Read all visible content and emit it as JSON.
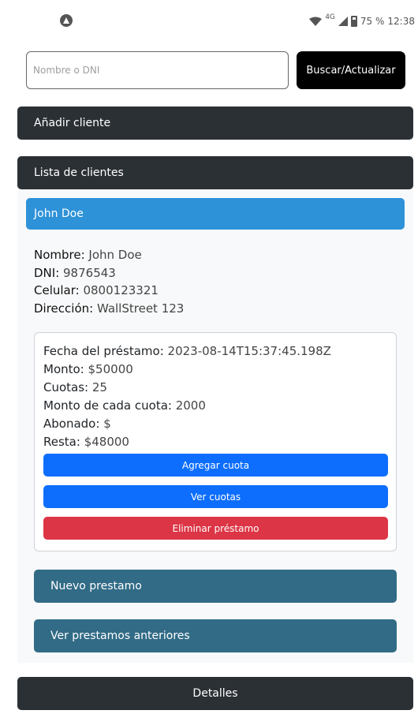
{
  "status_bar": {
    "network": "4G",
    "battery": "75 %",
    "time": "12:38"
  },
  "search": {
    "placeholder": "Nombre o DNI",
    "button_label": "Buscar/Actualizar"
  },
  "add_client_label": "Añadir cliente",
  "client_list_label": "Lista de clientes",
  "client": {
    "header_name": "John Doe",
    "fields": [
      {
        "label": "Nombre:",
        "value": " John Doe"
      },
      {
        "label": "DNI:",
        "value": " 9876543"
      },
      {
        "label": "Celular:",
        "value": " 0800123321"
      },
      {
        "label": "Dirección:",
        "value": " WallStreet 123"
      }
    ]
  },
  "loan": {
    "fields": [
      {
        "label": "Fecha del préstamo:",
        "value": " 2023-08-14T15:37:45.198Z"
      },
      {
        "label": "Monto:",
        "value": " $50000"
      },
      {
        "label": "Cuotas:",
        "value": " 25"
      },
      {
        "label": "Monto de cada cuota:",
        "value": " 2000"
      },
      {
        "label": "Abonado:",
        "value": " $"
      },
      {
        "label": "Resta:",
        "value": " $48000"
      }
    ],
    "add_cuota_label": "Agregar cuota",
    "view_cuotas_label": "Ver cuotas",
    "delete_loan_label": "Eliminar préstamo"
  },
  "new_loan_label": "Nuevo prestamo",
  "previous_loans_label": "Ver prestamos anteriores",
  "details_label": "Detalles",
  "colors": {
    "dark_bar": "#2b3035",
    "client_header": "#2e92d9",
    "primary_button": "#0d6efd",
    "danger_button": "#dc3545",
    "teal_bar": "#316b86"
  }
}
